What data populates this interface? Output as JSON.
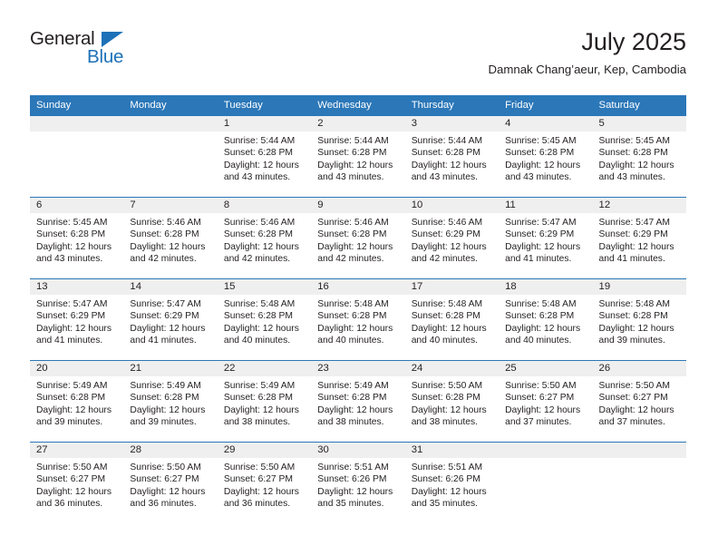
{
  "logo": {
    "word_top": "General",
    "word_bottom": "Blue",
    "triangle_icon": "triangle-icon",
    "color_text": "#231f20",
    "color_blue": "#1d71b8"
  },
  "header": {
    "title": "July 2025",
    "subtitle": "Damnak Chang’aeur, Kep, Cambodia"
  },
  "theme": {
    "header_bg": "#2b77b8",
    "header_text": "#ffffff",
    "daynum_bg": "#efefef",
    "body_text": "#231f20",
    "cell_bg": "#ffffff"
  },
  "weekday_headers": [
    "Sunday",
    "Monday",
    "Tuesday",
    "Wednesday",
    "Thursday",
    "Friday",
    "Saturday"
  ],
  "weeks": [
    [
      {
        "day": "",
        "empty": true,
        "sunrise": "",
        "sunset": "",
        "daylight": ""
      },
      {
        "day": "",
        "empty": true,
        "sunrise": "",
        "sunset": "",
        "daylight": ""
      },
      {
        "day": "1",
        "empty": false,
        "sunrise": "Sunrise: 5:44 AM",
        "sunset": "Sunset: 6:28 PM",
        "daylight": "Daylight: 12 hours and 43 minutes."
      },
      {
        "day": "2",
        "empty": false,
        "sunrise": "Sunrise: 5:44 AM",
        "sunset": "Sunset: 6:28 PM",
        "daylight": "Daylight: 12 hours and 43 minutes."
      },
      {
        "day": "3",
        "empty": false,
        "sunrise": "Sunrise: 5:44 AM",
        "sunset": "Sunset: 6:28 PM",
        "daylight": "Daylight: 12 hours and 43 minutes."
      },
      {
        "day": "4",
        "empty": false,
        "sunrise": "Sunrise: 5:45 AM",
        "sunset": "Sunset: 6:28 PM",
        "daylight": "Daylight: 12 hours and 43 minutes."
      },
      {
        "day": "5",
        "empty": false,
        "sunrise": "Sunrise: 5:45 AM",
        "sunset": "Sunset: 6:28 PM",
        "daylight": "Daylight: 12 hours and 43 minutes."
      }
    ],
    [
      {
        "day": "6",
        "empty": false,
        "sunrise": "Sunrise: 5:45 AM",
        "sunset": "Sunset: 6:28 PM",
        "daylight": "Daylight: 12 hours and 43 minutes."
      },
      {
        "day": "7",
        "empty": false,
        "sunrise": "Sunrise: 5:46 AM",
        "sunset": "Sunset: 6:28 PM",
        "daylight": "Daylight: 12 hours and 42 minutes."
      },
      {
        "day": "8",
        "empty": false,
        "sunrise": "Sunrise: 5:46 AM",
        "sunset": "Sunset: 6:28 PM",
        "daylight": "Daylight: 12 hours and 42 minutes."
      },
      {
        "day": "9",
        "empty": false,
        "sunrise": "Sunrise: 5:46 AM",
        "sunset": "Sunset: 6:28 PM",
        "daylight": "Daylight: 12 hours and 42 minutes."
      },
      {
        "day": "10",
        "empty": false,
        "sunrise": "Sunrise: 5:46 AM",
        "sunset": "Sunset: 6:29 PM",
        "daylight": "Daylight: 12 hours and 42 minutes."
      },
      {
        "day": "11",
        "empty": false,
        "sunrise": "Sunrise: 5:47 AM",
        "sunset": "Sunset: 6:29 PM",
        "daylight": "Daylight: 12 hours and 41 minutes."
      },
      {
        "day": "12",
        "empty": false,
        "sunrise": "Sunrise: 5:47 AM",
        "sunset": "Sunset: 6:29 PM",
        "daylight": "Daylight: 12 hours and 41 minutes."
      }
    ],
    [
      {
        "day": "13",
        "empty": false,
        "sunrise": "Sunrise: 5:47 AM",
        "sunset": "Sunset: 6:29 PM",
        "daylight": "Daylight: 12 hours and 41 minutes."
      },
      {
        "day": "14",
        "empty": false,
        "sunrise": "Sunrise: 5:47 AM",
        "sunset": "Sunset: 6:29 PM",
        "daylight": "Daylight: 12 hours and 41 minutes."
      },
      {
        "day": "15",
        "empty": false,
        "sunrise": "Sunrise: 5:48 AM",
        "sunset": "Sunset: 6:28 PM",
        "daylight": "Daylight: 12 hours and 40 minutes."
      },
      {
        "day": "16",
        "empty": false,
        "sunrise": "Sunrise: 5:48 AM",
        "sunset": "Sunset: 6:28 PM",
        "daylight": "Daylight: 12 hours and 40 minutes."
      },
      {
        "day": "17",
        "empty": false,
        "sunrise": "Sunrise: 5:48 AM",
        "sunset": "Sunset: 6:28 PM",
        "daylight": "Daylight: 12 hours and 40 minutes."
      },
      {
        "day": "18",
        "empty": false,
        "sunrise": "Sunrise: 5:48 AM",
        "sunset": "Sunset: 6:28 PM",
        "daylight": "Daylight: 12 hours and 40 minutes."
      },
      {
        "day": "19",
        "empty": false,
        "sunrise": "Sunrise: 5:48 AM",
        "sunset": "Sunset: 6:28 PM",
        "daylight": "Daylight: 12 hours and 39 minutes."
      }
    ],
    [
      {
        "day": "20",
        "empty": false,
        "sunrise": "Sunrise: 5:49 AM",
        "sunset": "Sunset: 6:28 PM",
        "daylight": "Daylight: 12 hours and 39 minutes."
      },
      {
        "day": "21",
        "empty": false,
        "sunrise": "Sunrise: 5:49 AM",
        "sunset": "Sunset: 6:28 PM",
        "daylight": "Daylight: 12 hours and 39 minutes."
      },
      {
        "day": "22",
        "empty": false,
        "sunrise": "Sunrise: 5:49 AM",
        "sunset": "Sunset: 6:28 PM",
        "daylight": "Daylight: 12 hours and 38 minutes."
      },
      {
        "day": "23",
        "empty": false,
        "sunrise": "Sunrise: 5:49 AM",
        "sunset": "Sunset: 6:28 PM",
        "daylight": "Daylight: 12 hours and 38 minutes."
      },
      {
        "day": "24",
        "empty": false,
        "sunrise": "Sunrise: 5:50 AM",
        "sunset": "Sunset: 6:28 PM",
        "daylight": "Daylight: 12 hours and 38 minutes."
      },
      {
        "day": "25",
        "empty": false,
        "sunrise": "Sunrise: 5:50 AM",
        "sunset": "Sunset: 6:27 PM",
        "daylight": "Daylight: 12 hours and 37 minutes."
      },
      {
        "day": "26",
        "empty": false,
        "sunrise": "Sunrise: 5:50 AM",
        "sunset": "Sunset: 6:27 PM",
        "daylight": "Daylight: 12 hours and 37 minutes."
      }
    ],
    [
      {
        "day": "27",
        "empty": false,
        "sunrise": "Sunrise: 5:50 AM",
        "sunset": "Sunset: 6:27 PM",
        "daylight": "Daylight: 12 hours and 36 minutes."
      },
      {
        "day": "28",
        "empty": false,
        "sunrise": "Sunrise: 5:50 AM",
        "sunset": "Sunset: 6:27 PM",
        "daylight": "Daylight: 12 hours and 36 minutes."
      },
      {
        "day": "29",
        "empty": false,
        "sunrise": "Sunrise: 5:50 AM",
        "sunset": "Sunset: 6:27 PM",
        "daylight": "Daylight: 12 hours and 36 minutes."
      },
      {
        "day": "30",
        "empty": false,
        "sunrise": "Sunrise: 5:51 AM",
        "sunset": "Sunset: 6:26 PM",
        "daylight": "Daylight: 12 hours and 35 minutes."
      },
      {
        "day": "31",
        "empty": false,
        "sunrise": "Sunrise: 5:51 AM",
        "sunset": "Sunset: 6:26 PM",
        "daylight": "Daylight: 12 hours and 35 minutes."
      },
      {
        "day": "",
        "empty": true,
        "sunrise": "",
        "sunset": "",
        "daylight": ""
      },
      {
        "day": "",
        "empty": true,
        "sunrise": "",
        "sunset": "",
        "daylight": ""
      }
    ]
  ]
}
